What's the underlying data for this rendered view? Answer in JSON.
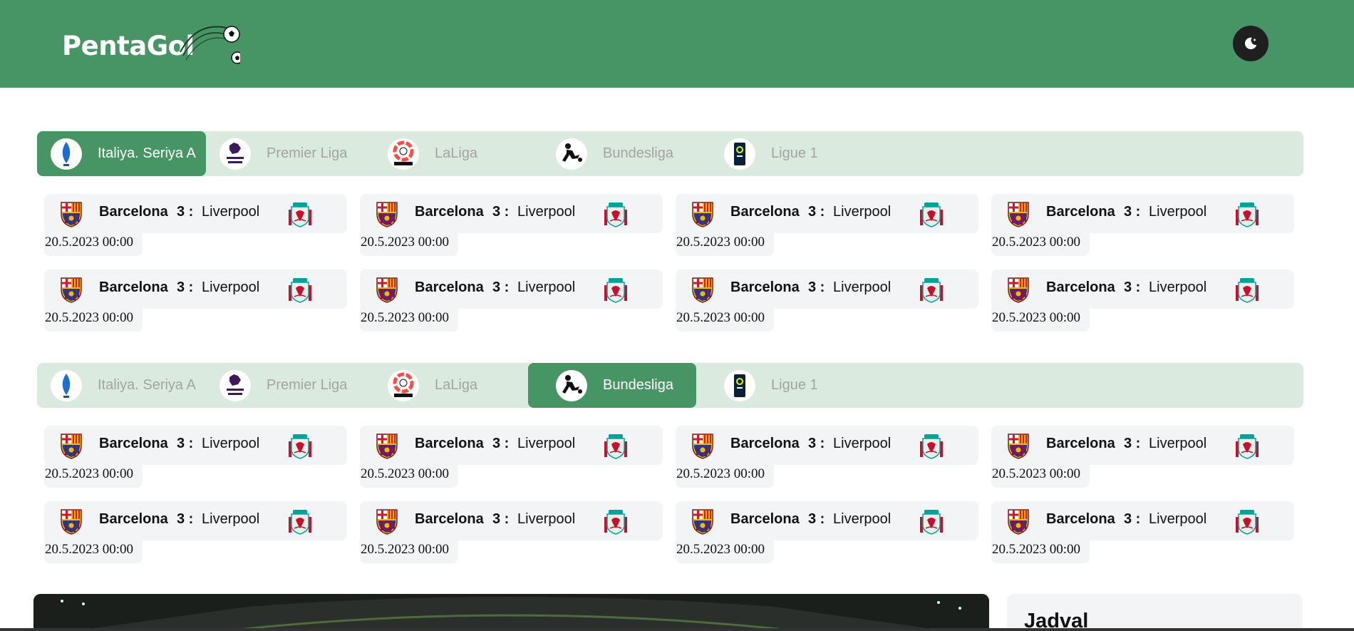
{
  "header": {
    "logo_text": "PentaGol",
    "background": "#479464",
    "theme_toggle_icon": "moon-stars-icon"
  },
  "sections": [
    {
      "tabs": [
        {
          "label": "Italiya. Seriya A",
          "icon": "serie-a-logo-icon",
          "active": true
        },
        {
          "label": "Premier Liga",
          "icon": "premier-league-logo-icon",
          "active": false
        },
        {
          "label": "LaLiga",
          "icon": "laliga-logo-icon",
          "active": false
        },
        {
          "label": "Bundesliga",
          "icon": "bundesliga-logo-icon",
          "active": false
        },
        {
          "label": "Ligue 1",
          "icon": "ligue1-logo-icon",
          "active": false
        }
      ],
      "matches": [
        {
          "home": "Barcelona",
          "score": "3 :",
          "away": "Liverpool",
          "date": "20.5.2023 00:00"
        },
        {
          "home": "Barcelona",
          "score": "3 :",
          "away": "Liverpool",
          "date": "20.5.2023 00:00"
        },
        {
          "home": "Barcelona",
          "score": "3 :",
          "away": "Liverpool",
          "date": "20.5.2023 00:00"
        },
        {
          "home": "Barcelona",
          "score": "3 :",
          "away": "Liverpool",
          "date": "20.5.2023 00:00"
        },
        {
          "home": "Barcelona",
          "score": "3 :",
          "away": "Liverpool",
          "date": "20.5.2023 00:00"
        },
        {
          "home": "Barcelona",
          "score": "3 :",
          "away": "Liverpool",
          "date": "20.5.2023 00:00"
        },
        {
          "home": "Barcelona",
          "score": "3 :",
          "away": "Liverpool",
          "date": "20.5.2023 00:00"
        },
        {
          "home": "Barcelona",
          "score": "3 :",
          "away": "Liverpool",
          "date": "20.5.2023 00:00"
        }
      ]
    },
    {
      "tabs": [
        {
          "label": "Italiya. Seriya A",
          "icon": "serie-a-logo-icon",
          "active": false
        },
        {
          "label": "Premier Liga",
          "icon": "premier-league-logo-icon",
          "active": false
        },
        {
          "label": "LaLiga",
          "icon": "laliga-logo-icon",
          "active": false
        },
        {
          "label": "Bundesliga",
          "icon": "bundesliga-logo-icon",
          "active": true
        },
        {
          "label": "Ligue 1",
          "icon": "ligue1-logo-icon",
          "active": false
        }
      ],
      "matches": [
        {
          "home": "Barcelona",
          "score": "3 :",
          "away": "Liverpool",
          "date": "20.5.2023 00:00"
        },
        {
          "home": "Barcelona",
          "score": "3 :",
          "away": "Liverpool",
          "date": "20.5.2023 00:00"
        },
        {
          "home": "Barcelona",
          "score": "3 :",
          "away": "Liverpool",
          "date": "20.5.2023 00:00"
        },
        {
          "home": "Barcelona",
          "score": "3 :",
          "away": "Liverpool",
          "date": "20.5.2023 00:00"
        },
        {
          "home": "Barcelona",
          "score": "3 :",
          "away": "Liverpool",
          "date": "20.5.2023 00:00"
        },
        {
          "home": "Barcelona",
          "score": "3 :",
          "away": "Liverpool",
          "date": "20.5.2023 00:00"
        },
        {
          "home": "Barcelona",
          "score": "3 :",
          "away": "Liverpool",
          "date": "20.5.2023 00:00"
        },
        {
          "home": "Barcelona",
          "score": "3 :",
          "away": "Liverpool",
          "date": "20.5.2023 00:00"
        }
      ]
    }
  ],
  "sidebar": {
    "table_title": "Jadval"
  },
  "colors": {
    "brand_green": "#479464",
    "tab_bar_bg": "#dbeadf",
    "card_bg": "#f3f4f6",
    "inactive_tab_text": "#a3a3a3"
  },
  "crests": {
    "home": "barcelona-crest-icon",
    "away": "liverpool-crest-icon"
  }
}
